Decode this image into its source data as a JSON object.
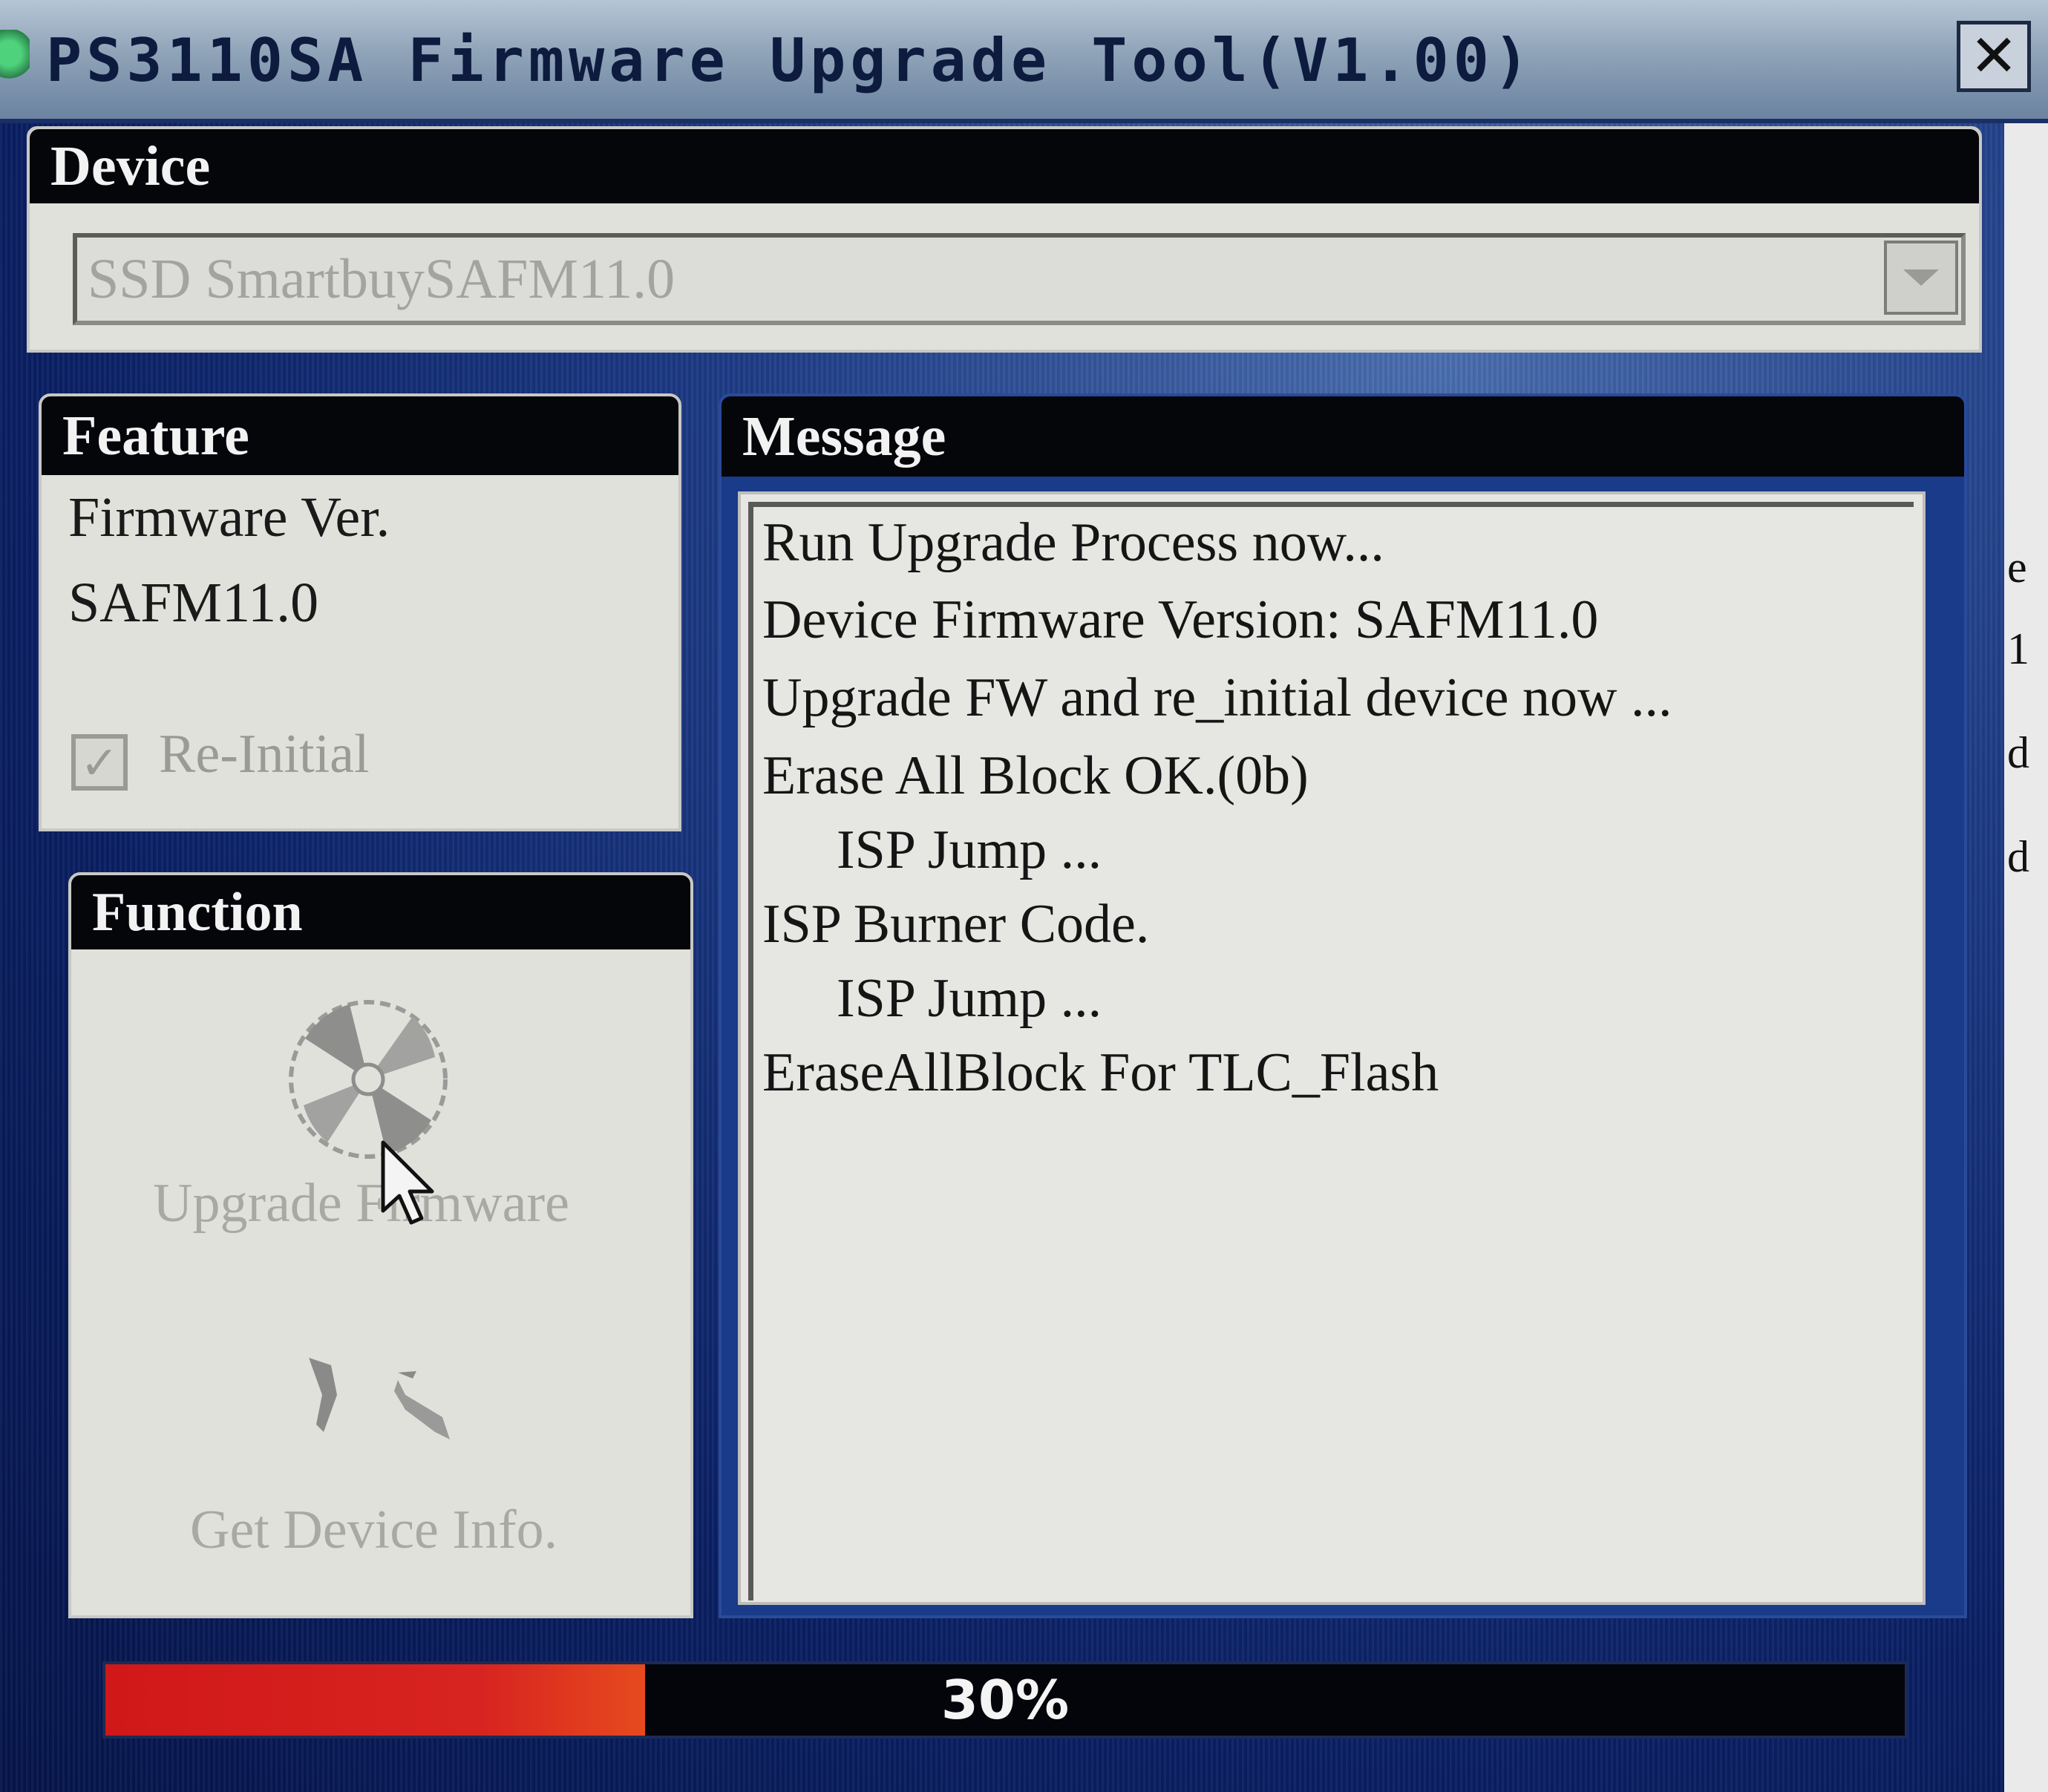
{
  "window": {
    "title": "PS3110SA Firmware Upgrade Tool(V1.00)",
    "close_glyph": "✕"
  },
  "device": {
    "header": "Device",
    "selected": "SSD SmartbuySAFM11.0"
  },
  "feature": {
    "header": "Feature",
    "firmware_label": "Firmware Ver.",
    "firmware_value": "SAFM11.0",
    "reinitial_label": "Re-Initial",
    "reinitial_checked": true,
    "check_glyph": "✓"
  },
  "function": {
    "header": "Function",
    "upgrade_label": "Upgrade Firmware",
    "upgrade_icon": "disc-icon",
    "info_label": "Get Device Info.",
    "info_icon": "tools-icon"
  },
  "message": {
    "header": "Message",
    "lines": [
      "Run Upgrade Process now...",
      "Device Firmware Version: SAFM11.0",
      "Upgrade FW and re_initial device now ...",
      "Erase All Block OK.(0b)",
      "ISP Jump ...",
      "ISP Burner Code.",
      "ISP Jump ...",
      "EraseAllBlock For TLC_Flash"
    ]
  },
  "progress": {
    "value_percent": 30,
    "label": "30%",
    "fill_color": "#d01818"
  },
  "background_window": {
    "edge_letters": [
      "e",
      "1",
      "d",
      "d"
    ]
  }
}
